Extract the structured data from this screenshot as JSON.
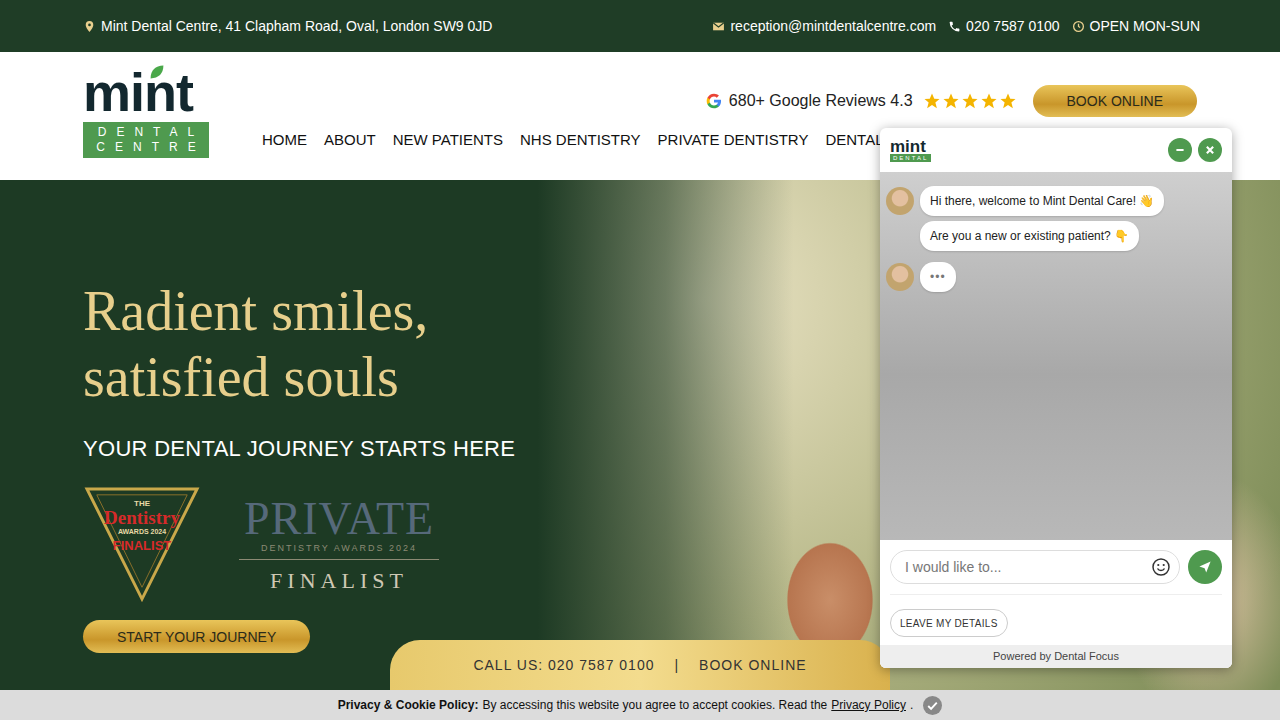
{
  "topbar": {
    "address": "Mint Dental Centre, 41 Clapham Road, Oval, London SW9 0JD",
    "email": "reception@mintdentalcentre.com",
    "phone": "020 7587 0100",
    "hours": "OPEN MON-SUN"
  },
  "logo": {
    "word": "mint",
    "lines": [
      "DENTAL",
      "CENTRE"
    ]
  },
  "reviews": {
    "label": "680+ Google Reviews 4.3",
    "stars": 5
  },
  "book_button": "BOOK ONLINE",
  "nav": [
    "HOME",
    "ABOUT",
    "NEW PATIENTS",
    "NHS DENTISTRY",
    "PRIVATE DENTISTRY",
    "DENTAL IMPLA"
  ],
  "hero": {
    "title": [
      "Radient smiles,",
      "satisfied souls"
    ],
    "subtitle": "YOUR DENTAL JOURNEY STARTS HERE",
    "award_one": {
      "top": "THE",
      "name": "Dentistry",
      "year": "AWARDS 2024",
      "status": "FINALIST"
    },
    "award_two": {
      "name": "PRIVATE",
      "year": "DENTISTRY AWARDS 2024",
      "status": "FINALIST"
    },
    "button": "START YOUR JOURNEY"
  },
  "call_bar": {
    "call": "CALL US: 020 7587 0100",
    "separator": "|",
    "book": "BOOK ONLINE"
  },
  "chat": {
    "logo_word": "mint",
    "logo_sub": "DENTAL",
    "messages": [
      {
        "text": "Hi there, welcome to Mint Dental Care! 👋",
        "avatar": true
      },
      {
        "text": "Are you a new or existing patient? 👇",
        "avatar": false
      }
    ],
    "typing": "•••",
    "placeholder": "I would like to...",
    "leave_button": "LEAVE MY DETAILS",
    "footer": "Powered by Dental Focus"
  },
  "cookie": {
    "title": "Privacy & Cookie Policy:",
    "text": "By accessing this website you agree to accept cookies. Read the",
    "link": "Privacy Policy",
    "end": "."
  }
}
